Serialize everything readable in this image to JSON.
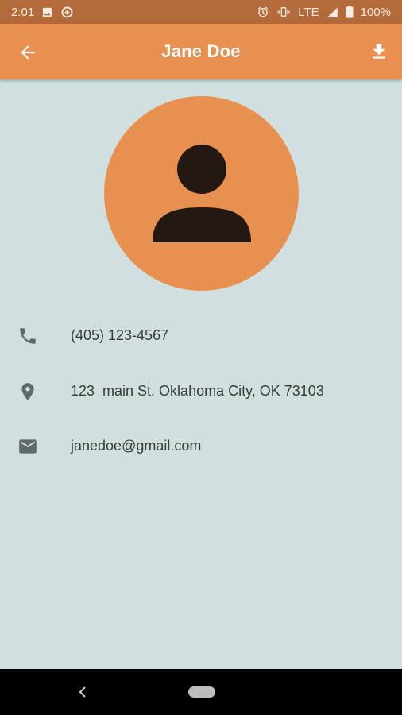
{
  "status_bar": {
    "time": "2:01",
    "network": "LTE",
    "battery": "100%",
    "icons_left": [
      "image-icon",
      "data-saver-icon"
    ],
    "icons_right": [
      "alarm-icon",
      "vibrate-icon",
      "signal-icon",
      "battery-icon"
    ]
  },
  "app_bar": {
    "title": "Jane Doe",
    "back_icon": "arrow-back-icon",
    "action_icon": "download-icon",
    "color": "#e8904f"
  },
  "avatar": {
    "icon": "person-icon",
    "background": "#e8904f",
    "foreground": "#241813"
  },
  "contact": {
    "phone": "(405) 123-4567",
    "address": "123  main St. Oklahoma City, OK 73103",
    "email": "janedoe@gmail.com",
    "icons": [
      "phone-icon",
      "location-pin-icon",
      "email-icon"
    ]
  },
  "colors": {
    "background": "#cfe0df",
    "status_bar": "#b46b3c",
    "text": "#3b3b3b",
    "icon": "#5f6a6a"
  }
}
